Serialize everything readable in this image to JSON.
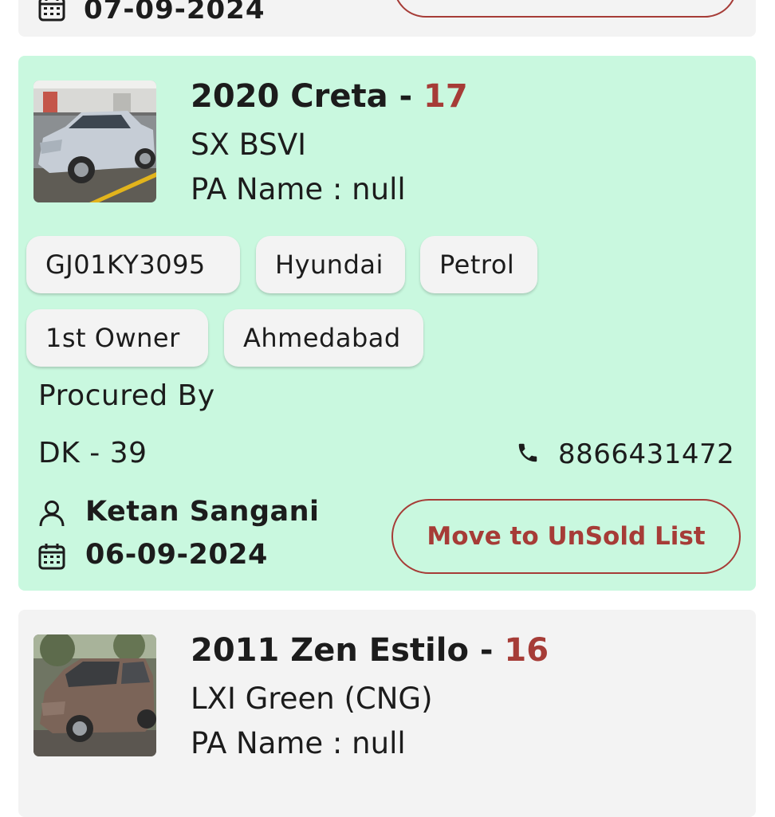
{
  "prev_card": {
    "date": "07-09-2024"
  },
  "main_card": {
    "year_model": "2020 Creta - ",
    "count": "17",
    "variant": "SX BSVI",
    "pa_name": "PA Name : null",
    "chips_row1": [
      "GJ01KY3095",
      "Hyundai",
      "Petrol"
    ],
    "chips_row2": [
      "1st  Owner",
      "Ahmedabad"
    ],
    "procured_label": "Procured By",
    "procurer": "DK - 39",
    "phone": "8866431472",
    "person": "Ketan Sangani",
    "date": "06-09-2024",
    "action_label": "Move to UnSold List"
  },
  "next_card": {
    "year_model": "2011 Zen Estilo - ",
    "count": "16",
    "variant": "LXI Green (CNG)",
    "pa_name": "PA Name : null"
  },
  "colors": {
    "accent": "#a63c37",
    "card_highlight": "#c9f8df",
    "card_default": "#f3f3f3",
    "chip_bg": "#f3f3f3"
  },
  "icons": [
    "calendar-icon",
    "phone-icon",
    "person-icon"
  ]
}
